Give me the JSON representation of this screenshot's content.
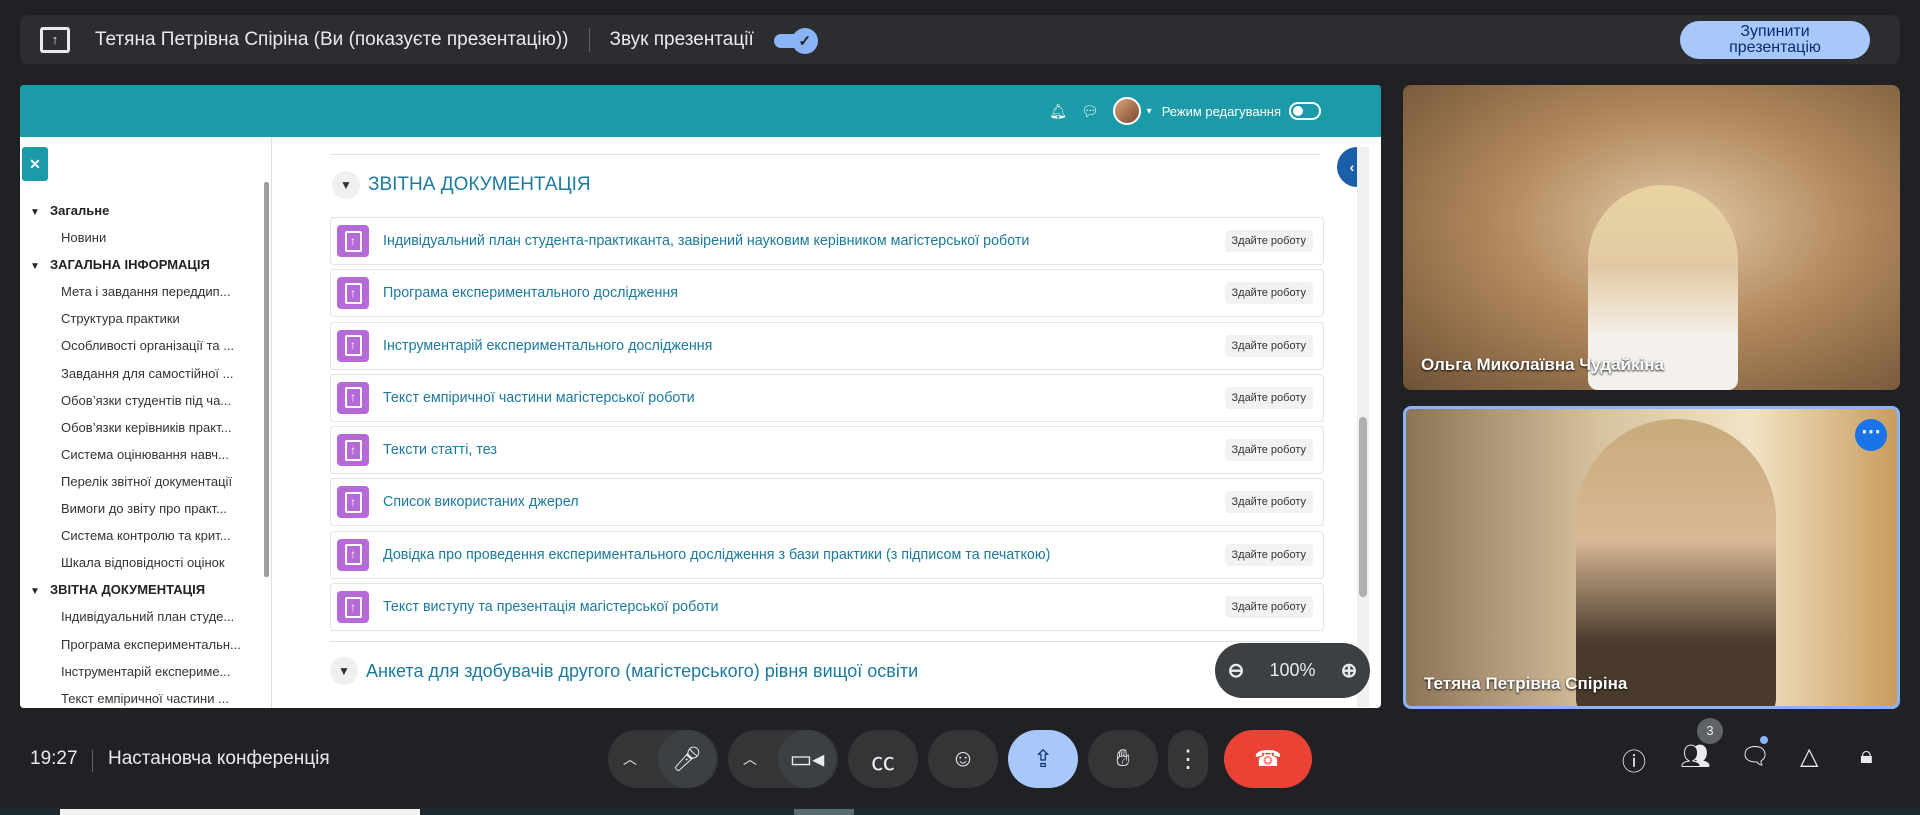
{
  "topbar": {
    "presenter": "Тетяна Петрівна Спіріна (Ви (показуєте презентацію))",
    "sound_label": "Звук презентації",
    "stop_line1": "Зупинити",
    "stop_line2": "презентацію"
  },
  "moodle": {
    "header": {
      "edit_mode": "Режим редагування"
    },
    "sidebar": {
      "items": [
        {
          "type": "section",
          "label": "Загальне"
        },
        {
          "type": "item",
          "label": "Новини"
        },
        {
          "type": "section",
          "label": "ЗАГАЛЬНА ІНФОРМАЦІЯ"
        },
        {
          "type": "item",
          "label": "Мета і завдання переддип..."
        },
        {
          "type": "item",
          "label": "Структура практики"
        },
        {
          "type": "item",
          "label": "Особливості організації та ..."
        },
        {
          "type": "item",
          "label": "Завдання для самостійної ..."
        },
        {
          "type": "item",
          "label": "Обов’язки студентів під ча..."
        },
        {
          "type": "item",
          "label": "Обов’язки керівників практ..."
        },
        {
          "type": "item",
          "label": "Система оцінювання навч..."
        },
        {
          "type": "item",
          "label": "Перелік звітної документації"
        },
        {
          "type": "item",
          "label": "Вимоги до звіту про практ..."
        },
        {
          "type": "item",
          "label": "Система контролю та крит..."
        },
        {
          "type": "item",
          "label": "Шкала відповідності оцінок"
        },
        {
          "type": "section",
          "label": "ЗВІТНА ДОКУМЕНТАЦІЯ"
        },
        {
          "type": "item",
          "label": "Індивідуальний план студе..."
        },
        {
          "type": "item",
          "label": "Програма експериментальн..."
        },
        {
          "type": "item",
          "label": "Інструментарій експериме..."
        },
        {
          "type": "item",
          "label": "Текст емпіричної частини ..."
        }
      ]
    },
    "section_title": "ЗВІТНА ДОКУМЕНТАЦІЯ",
    "activities": [
      {
        "name": "Індивідуальний план студента-практиканта, завірений науковим керівником магістерської роботи",
        "badge": "Здайте роботу"
      },
      {
        "name": "Програма експериментального дослідження",
        "badge": "Здайте роботу"
      },
      {
        "name": "Інструментарій експериментального дослідження",
        "badge": "Здайте роботу"
      },
      {
        "name": "Текст емпіричної частини магістерської роботи",
        "badge": "Здайте роботу"
      },
      {
        "name": "Тексти статті, тез",
        "badge": "Здайте роботу"
      },
      {
        "name": "Список використаних джерел",
        "badge": "Здайте роботу"
      },
      {
        "name": "Довідка про проведення експериментального дослідження з бази практики (з підписом та печаткою)",
        "badge": "Здайте роботу"
      },
      {
        "name": "Текст виступу та презентація магістерської роботи",
        "badge": "Здайте роботу"
      }
    ],
    "next_section": "Анкета для здобувачів другого (магістерського) рівня вищої освіти"
  },
  "zoom": {
    "level": "100%"
  },
  "participants": [
    {
      "name": "Ольга Миколаївна Чудайкіна"
    },
    {
      "name": "Тетяна Петрівна Спіріна"
    }
  ],
  "bottom": {
    "time": "19:27",
    "meeting": "Настановча конференція",
    "people_count": "3"
  },
  "colors": {
    "moodle_teal": "#1b9aa8",
    "link_blue": "#1b7a9e",
    "assign_purple": "#b56ad8",
    "leave_red": "#ea4335",
    "present_blue": "#a8c7fa"
  }
}
